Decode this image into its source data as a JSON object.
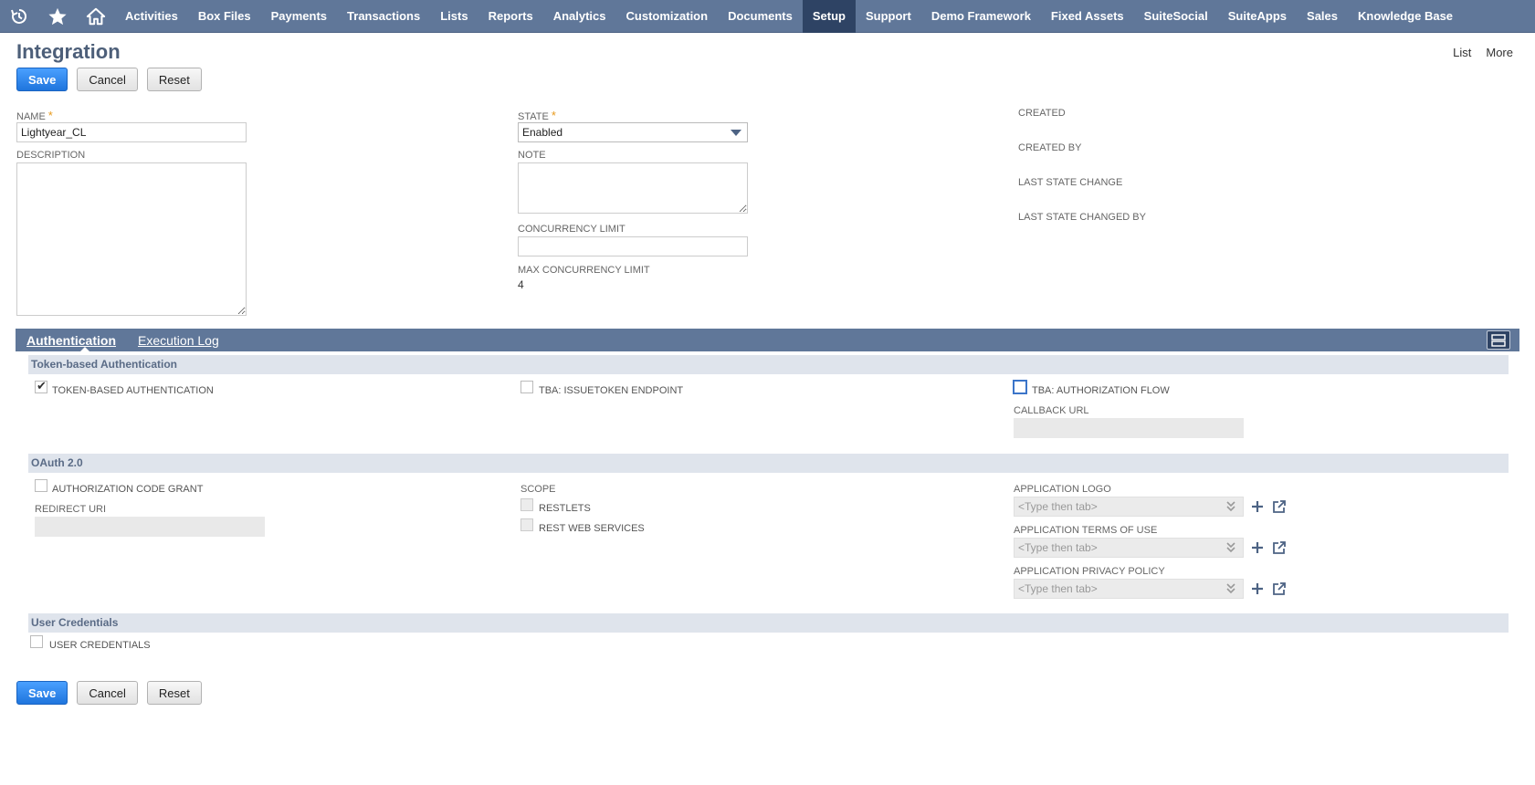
{
  "nav": {
    "items": [
      {
        "label": "Activities"
      },
      {
        "label": "Box Files"
      },
      {
        "label": "Payments"
      },
      {
        "label": "Transactions"
      },
      {
        "label": "Lists"
      },
      {
        "label": "Reports"
      },
      {
        "label": "Analytics"
      },
      {
        "label": "Customization"
      },
      {
        "label": "Documents"
      },
      {
        "label": "Setup"
      },
      {
        "label": "Support"
      },
      {
        "label": "Demo Framework"
      },
      {
        "label": "Fixed Assets"
      },
      {
        "label": "SuiteSocial"
      },
      {
        "label": "SuiteApps"
      },
      {
        "label": "Sales"
      },
      {
        "label": "Knowledge Base"
      }
    ],
    "active": "Setup"
  },
  "page": {
    "title": "Integration",
    "links": {
      "list": "List",
      "more": "More"
    }
  },
  "buttons": {
    "save": "Save",
    "cancel": "Cancel",
    "reset": "Reset"
  },
  "fields": {
    "name": {
      "label": "NAME",
      "value": "Lightyear_CL",
      "required": "*"
    },
    "description": {
      "label": "DESCRIPTION"
    },
    "state": {
      "label": "STATE",
      "value": "Enabled",
      "required": "*"
    },
    "note": {
      "label": "NOTE"
    },
    "concurrency_limit": {
      "label": "CONCURRENCY LIMIT",
      "value": ""
    },
    "max_concurrency_limit": {
      "label": "MAX CONCURRENCY LIMIT",
      "value": "4"
    },
    "created": {
      "label": "CREATED"
    },
    "created_by": {
      "label": "CREATED BY"
    },
    "last_state_change": {
      "label": "LAST STATE CHANGE"
    },
    "last_state_changed_by": {
      "label": "LAST STATE CHANGED BY"
    }
  },
  "tabs": {
    "authentication": "Authentication",
    "execution_log": "Execution Log"
  },
  "tba": {
    "heading": "Token-based Authentication",
    "token_based_auth": {
      "label": "TOKEN-BASED AUTHENTICATION",
      "checked": true
    },
    "issuetoken_endpoint": {
      "label": "TBA: ISSUETOKEN ENDPOINT",
      "checked": false
    },
    "authorization_flow": {
      "label": "TBA: AUTHORIZATION FLOW",
      "checked": false
    },
    "callback_url": {
      "label": "CALLBACK URL"
    }
  },
  "oauth": {
    "heading": "OAuth 2.0",
    "auth_code_grant": {
      "label": "AUTHORIZATION CODE GRANT",
      "checked": false
    },
    "redirect_uri": {
      "label": "REDIRECT URI"
    },
    "scope": {
      "label": "SCOPE",
      "restlets": "RESTLETS",
      "rest_web_services": "REST WEB SERVICES"
    },
    "application_logo": {
      "label": "APPLICATION LOGO",
      "placeholder": "<Type then tab>"
    },
    "terms_of_use": {
      "label": "APPLICATION TERMS OF USE",
      "placeholder": "<Type then tab>"
    },
    "privacy_policy": {
      "label": "APPLICATION PRIVACY POLICY",
      "placeholder": "<Type then tab>"
    }
  },
  "user_credentials": {
    "heading": "User Credentials",
    "checkbox": {
      "label": "USER CREDENTIALS",
      "checked": false
    }
  },
  "colors": {
    "nav_bg": "#607799",
    "nav_active": "#2e4364",
    "primary_button": "#1f75dd",
    "section_bg": "#dfe4ec"
  }
}
